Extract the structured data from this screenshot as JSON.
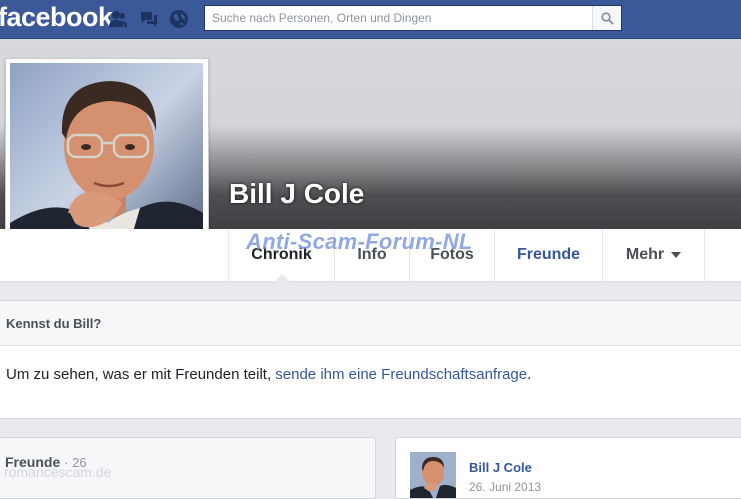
{
  "header": {
    "logo": "facebook",
    "search_placeholder": "Suche nach Personen, Orten und Dingen"
  },
  "profile": {
    "name": "Bill J Cole"
  },
  "nav": {
    "tabs": [
      {
        "label": "Chronik"
      },
      {
        "label": "Info"
      },
      {
        "label": "Fotos"
      },
      {
        "label": "Freunde"
      },
      {
        "label": "Mehr"
      }
    ]
  },
  "watermark": "Anti-Scam-Forum-NL",
  "know": {
    "title": "Kennst du Bill?",
    "text_before": "Um zu sehen, was er mit Freunden teilt, ",
    "link": "sende ihm eine Freundschaftsanfrage",
    "text_after": "."
  },
  "friends": {
    "title": "Freunde",
    "separator": "·",
    "count": "26",
    "faint_overlay": "romancescam.de"
  },
  "post": {
    "author": "Bill J Cole",
    "date": "26. Juni 2013"
  },
  "colors": {
    "brand": "#3b5998",
    "link": "#365899",
    "background": "#e9eaed"
  }
}
